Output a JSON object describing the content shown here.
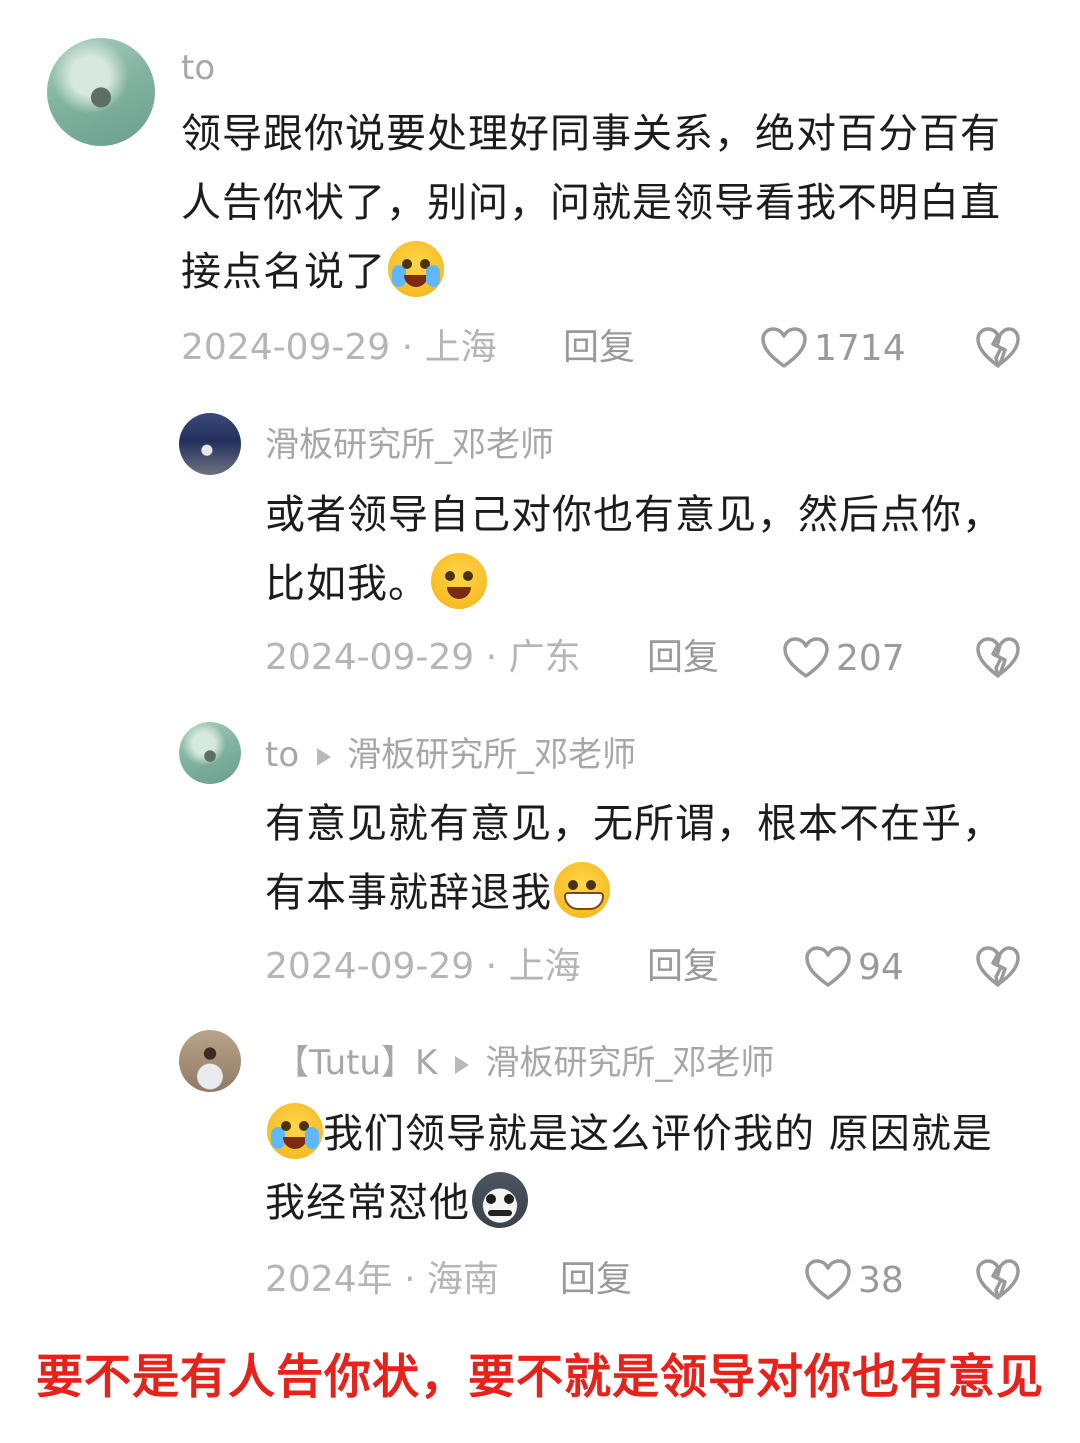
{
  "comments": [
    {
      "user": "to",
      "text": "领导跟你说要处理好同事关系，绝对百分百有人告你状了，别问，问就是领导看我不明白直接点名说了",
      "emoji_icon": "crying-laugh-emoji-icon",
      "date": "2024-09-29",
      "location": "上海",
      "reply_label": "回复",
      "likes": "1714"
    },
    {
      "user": "滑板研究所_邓老师",
      "text": "或者领导自己对你也有意见，然后点你，比如我。",
      "emoji_icon": "dazed-smile-emoji-icon",
      "date": "2024-09-29",
      "location": "广东",
      "reply_label": "回复",
      "likes": "207"
    },
    {
      "user": "to",
      "reply_to": "滑板研究所_邓老师",
      "text": "有意见就有意见，无所谓，根本不在乎，有本事就辞退我",
      "emoji_icon": "grin-emoji-icon",
      "date": "2024-09-29",
      "location": "上海",
      "reply_label": "回复",
      "likes": "94"
    },
    {
      "user": "【Tutu】K",
      "reply_to": "滑板研究所_邓老师",
      "text_emoji_icon": "crying-laugh-emoji-icon",
      "text": "我们领导就是这么评价我的 原因就是我经常怼他",
      "emoji_icon": "husky-dog-emoji-icon",
      "date": "2024年",
      "location": "海南",
      "reply_label": "回复",
      "likes": "38"
    }
  ],
  "separator": "·",
  "banner": "要不是有人告你状，要不就是领导对你也有意见",
  "colors": {
    "banner": "#e8211b",
    "username": "#a7a7a7",
    "meta": "#b5b5b5"
  }
}
